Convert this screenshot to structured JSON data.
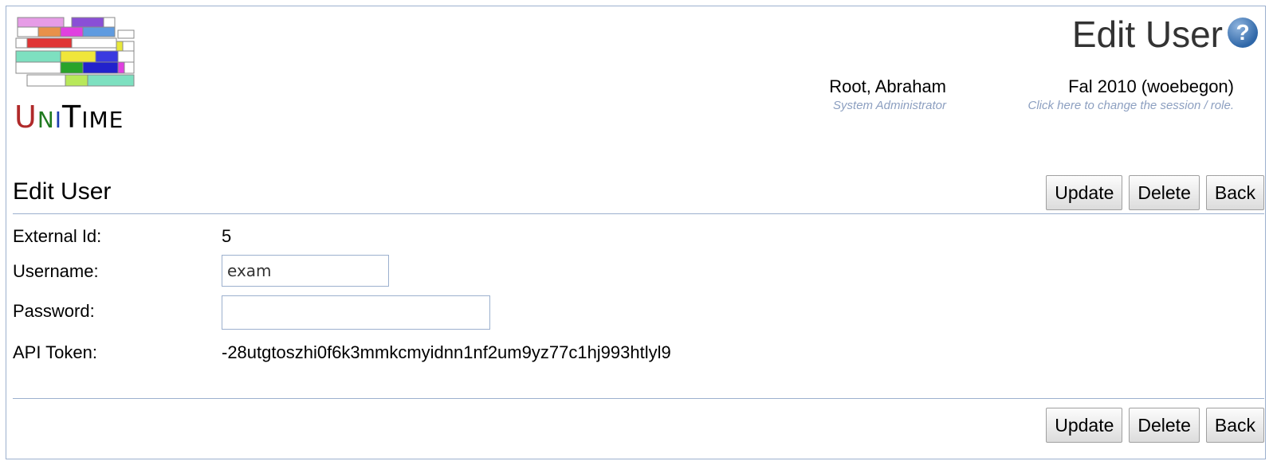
{
  "app": {
    "logo_letters": {
      "u": "U",
      "n": "N",
      "i": "I",
      "t": "T",
      "me": "IME"
    }
  },
  "header": {
    "page_title": "Edit User",
    "help_icon": "?",
    "user_name": "Root, Abraham",
    "user_role": "System Administrator",
    "session": "Fal 2010 (woebegon)",
    "session_hint": "Click here to change the session / role."
  },
  "section": {
    "title": "Edit User"
  },
  "buttons": {
    "update": "Update",
    "delete": "Delete",
    "back": "Back"
  },
  "form": {
    "external_id_label": "External Id:",
    "external_id_value": "5",
    "username_label": "Username:",
    "username_value": "exam",
    "password_label": "Password:",
    "password_value": "",
    "api_token_label": "API Token:",
    "api_token_value": "-28utgtoszhi0f6k3mmkcmyidnn1nf2um9yz77c1hj993htlyl9"
  },
  "colors": {
    "border": "#9cb0ce",
    "hint": "#8c9fc0"
  }
}
